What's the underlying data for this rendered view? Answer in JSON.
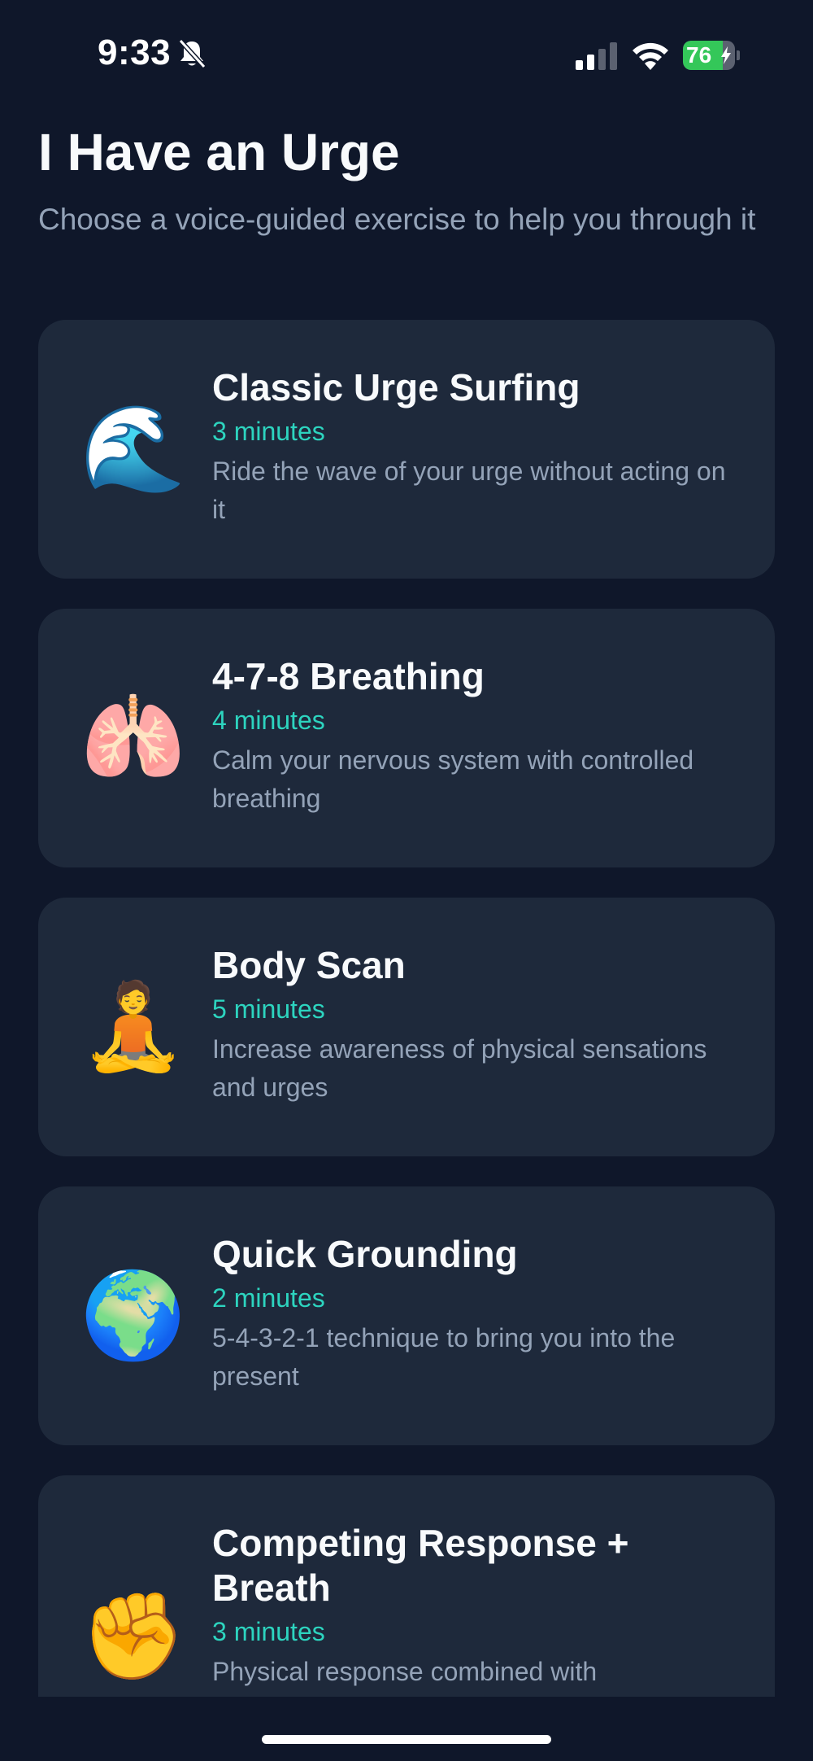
{
  "status_bar": {
    "time": "9:33",
    "battery_level": "76",
    "battery_color": "#34c759"
  },
  "header": {
    "title": "I Have an Urge",
    "subtitle": "Choose a voice-guided exercise to help you through it"
  },
  "exercises": [
    {
      "icon": "🌊",
      "icon_name": "wave-icon",
      "title": "Classic Urge Surfing",
      "duration": "3 minutes",
      "description": "Ride the wave of your urge without acting on it"
    },
    {
      "icon": "🫁",
      "icon_name": "lungs-icon",
      "title": "4-7-8 Breathing",
      "duration": "4 minutes",
      "description": "Calm your nervous system with controlled breathing"
    },
    {
      "icon": "🧘",
      "icon_name": "meditation-icon",
      "title": "Body Scan",
      "duration": "5 minutes",
      "description": "Increase awareness of physical sensations and urges"
    },
    {
      "icon": "🌍",
      "icon_name": "globe-icon",
      "title": "Quick Grounding",
      "duration": "2 minutes",
      "description": "5-4-3-2-1 technique to bring you into the present"
    },
    {
      "icon": "✊",
      "icon_name": "raised-fist-icon",
      "title": "Competing Response + Breath",
      "duration": "3 minutes",
      "description": "Physical response combined with"
    }
  ],
  "colors": {
    "background": "#0f172a",
    "card": "#1e293b",
    "accent": "#2dd4bf",
    "muted_text": "#94a3b8"
  }
}
